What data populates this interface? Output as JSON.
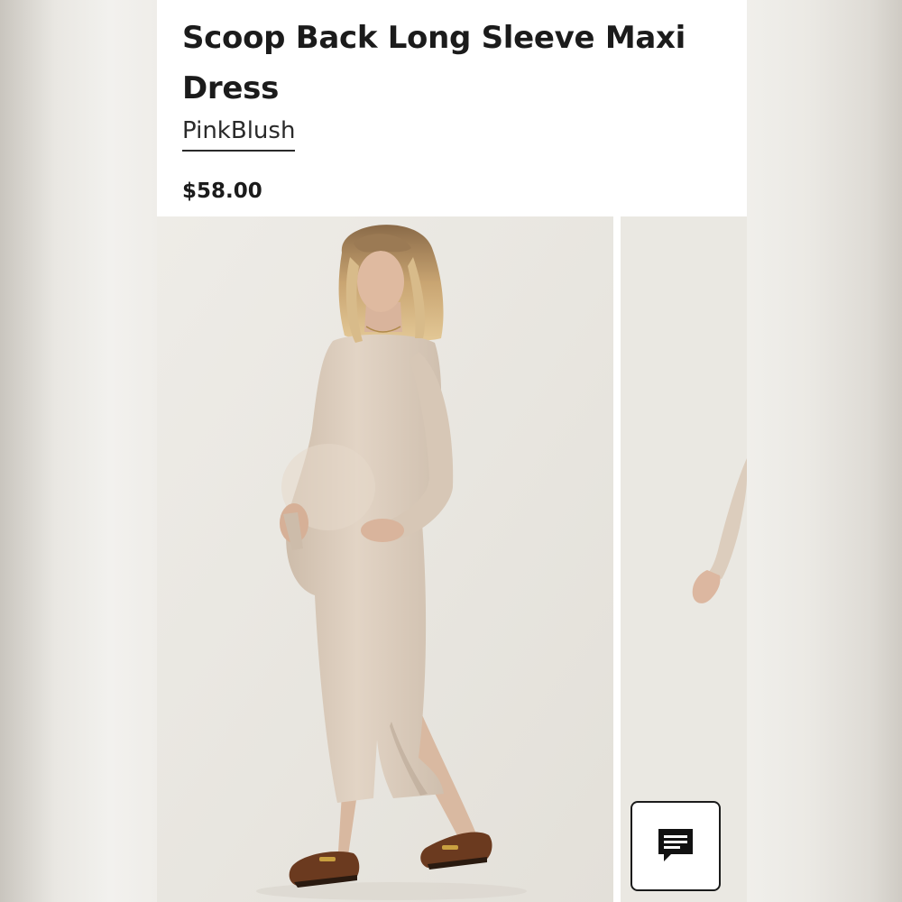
{
  "product": {
    "title": "Scoop Back Long Sleeve Maxi Dress",
    "brand": "PinkBlush",
    "price": "$58.00"
  },
  "gallery": {
    "images": [
      {
        "subject": "pregnant model in beige long sleeve maxi dress with brown loafers"
      },
      {
        "subject": "partial view of model arm in beige sleeve"
      }
    ]
  },
  "chat": {
    "icon": "chat-bubble-icon"
  },
  "colors": {
    "text": "#1b1b1b",
    "dress": "#dccdbd",
    "background": "#ebe9e3",
    "shoes": "#6b3a1f"
  }
}
